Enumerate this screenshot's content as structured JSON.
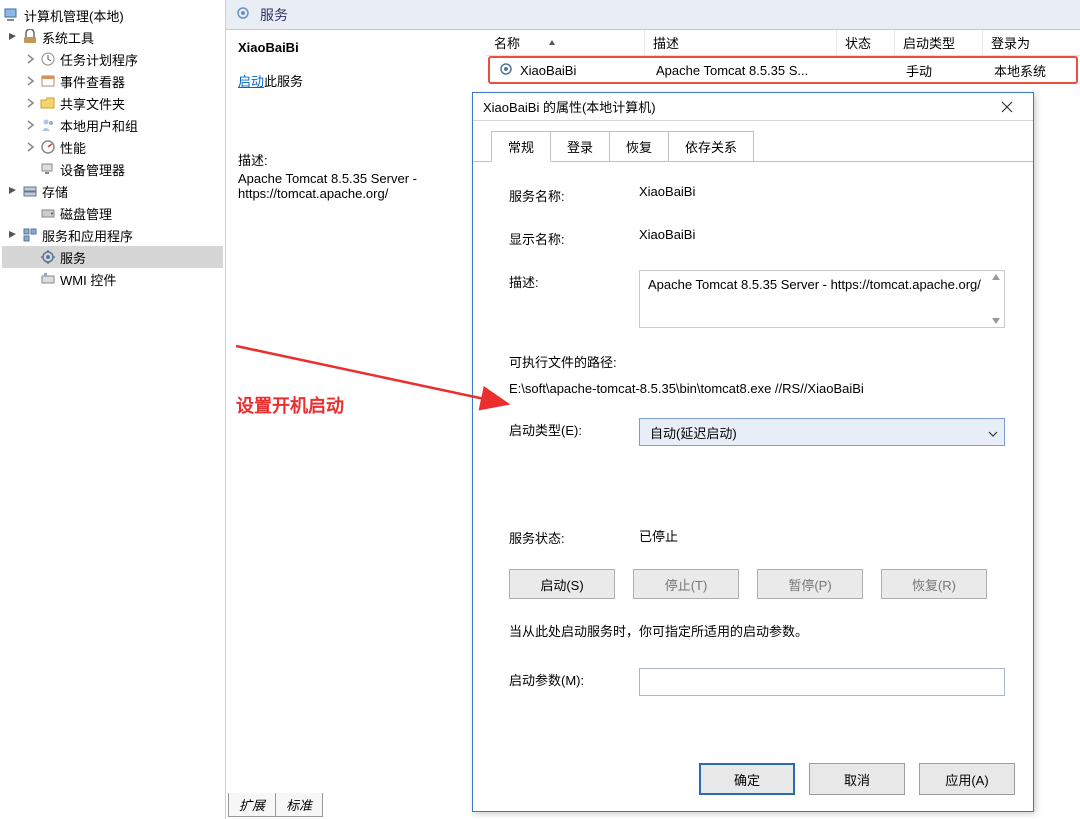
{
  "tree": {
    "root": "计算机管理(本地)",
    "sysTools": "系统工具",
    "taskScheduler": "任务计划程序",
    "eventViewer": "事件查看器",
    "sharedFolders": "共享文件夹",
    "localUsersGroups": "本地用户和组",
    "performance": "性能",
    "deviceManager": "设备管理器",
    "storage": "存储",
    "diskMgmt": "磁盘管理",
    "servicesApps": "服务和应用程序",
    "services": "服务",
    "wmi": "WMI 控件"
  },
  "servicesHeader": "服务",
  "detail": {
    "name": "XiaoBaiBi",
    "startLink": "启动",
    "startRest": "此服务",
    "descLabel": "描述:",
    "descText": "Apache Tomcat 8.5.35 Server - https://tomcat.apache.org/"
  },
  "columns": {
    "name": "名称",
    "desc": "描述",
    "status": "状态",
    "startType": "启动类型",
    "logonAs": "登录为"
  },
  "row": {
    "name": "XiaoBaiBi",
    "desc": "Apache Tomcat 8.5.35 S...",
    "status": "",
    "startType": "手动",
    "logonAs": "本地系统"
  },
  "bottomTabs": {
    "extended": "扩展",
    "standard": "标准"
  },
  "dialog": {
    "title": "XiaoBaiBi 的属性(本地计算机)",
    "tabs": {
      "general": "常规",
      "logon": "登录",
      "recovery": "恢复",
      "deps": "依存关系"
    },
    "labels": {
      "serviceName": "服务名称:",
      "displayName": "显示名称:",
      "desc": "描述:",
      "exePath": "可执行文件的路径:",
      "startType": "启动类型(E):",
      "serviceStatus": "服务状态:",
      "startParams": "启动参数(M):",
      "paramHint": "当从此处启动服务时，你可指定所适用的启动参数。"
    },
    "values": {
      "serviceName": "XiaoBaiBi",
      "displayName": "XiaoBaiBi",
      "desc": "Apache Tomcat 8.5.35 Server - https://tomcat.apache.org/",
      "exePath": "E:\\soft\\apache-tomcat-8.5.35\\bin\\tomcat8.exe //RS//XiaoBaiBi",
      "startType": "自动(延迟启动)",
      "serviceStatus": "已停止"
    },
    "buttons": {
      "start": "启动(S)",
      "stop": "停止(T)",
      "pause": "暂停(P)",
      "resume": "恢复(R)",
      "ok": "确定",
      "cancel": "取消",
      "apply": "应用(A)"
    }
  },
  "annotation": "设置开机启动"
}
